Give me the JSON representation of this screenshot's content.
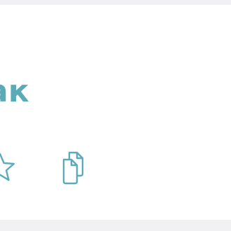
{
  "card": {
    "word": "ак"
  },
  "actions": [
    {
      "icon": "star-icon"
    },
    {
      "icon": "copy-icon"
    }
  ],
  "colors": {
    "accent": "#5aaab8",
    "page_background": "#f1f1f4",
    "card_background": "#ffffff"
  }
}
